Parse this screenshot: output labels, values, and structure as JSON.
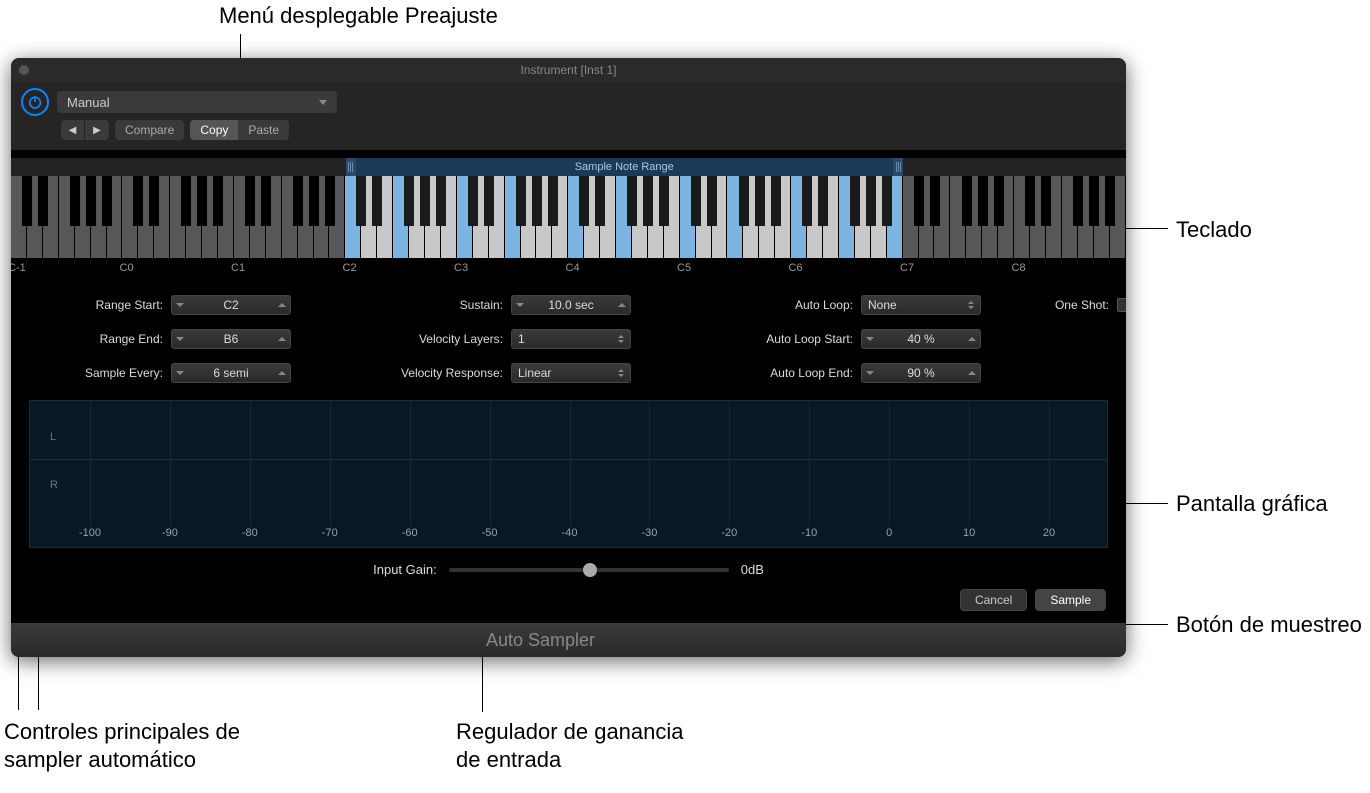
{
  "callouts": {
    "preset": "Menú desplegable Preajuste",
    "keyboard": "Teclado",
    "graphic": "Pantalla gráfica",
    "sample_btn": "Botón de muestreo",
    "main_controls_l1": "Controles principales de",
    "main_controls_l2": "sampler automático",
    "gain_l1": "Regulador de ganancia",
    "gain_l2": "de entrada"
  },
  "titlebar": "Instrument [Inst 1]",
  "toolbar": {
    "preset": "Manual",
    "compare": "Compare",
    "copy": "Copy",
    "paste": "Paste"
  },
  "keyboard": {
    "range_header": "Sample Note Range",
    "octaves": [
      "C-1",
      "C0",
      "C1",
      "C2",
      "C3",
      "C4",
      "C5",
      "C6",
      "C7",
      "C8"
    ]
  },
  "controls": {
    "range_start": {
      "label": "Range Start:",
      "value": "C2"
    },
    "range_end": {
      "label": "Range End:",
      "value": "B6"
    },
    "sample_every": {
      "label": "Sample Every:",
      "value": "6 semi"
    },
    "sustain": {
      "label": "Sustain:",
      "value": "10.0 sec"
    },
    "velocity_layers": {
      "label": "Velocity Layers:",
      "value": "1"
    },
    "velocity_response": {
      "label": "Velocity Response:",
      "value": "Linear"
    },
    "auto_loop": {
      "label": "Auto Loop:",
      "value": "None"
    },
    "auto_loop_start": {
      "label": "Auto Loop Start:",
      "value": "40 %"
    },
    "auto_loop_end": {
      "label": "Auto Loop End:",
      "value": "90 %"
    },
    "one_shot": {
      "label": "One Shot:"
    }
  },
  "waveform": {
    "l": "L",
    "r": "R",
    "db_ticks": [
      "-100",
      "-90",
      "-80",
      "-70",
      "-60",
      "-50",
      "-40",
      "-30",
      "-20",
      "-10",
      "0",
      "10",
      "20"
    ]
  },
  "input_gain": {
    "label": "Input Gain:",
    "value": "0dB"
  },
  "actions": {
    "cancel": "Cancel",
    "sample": "Sample"
  },
  "footer": "Auto Sampler"
}
